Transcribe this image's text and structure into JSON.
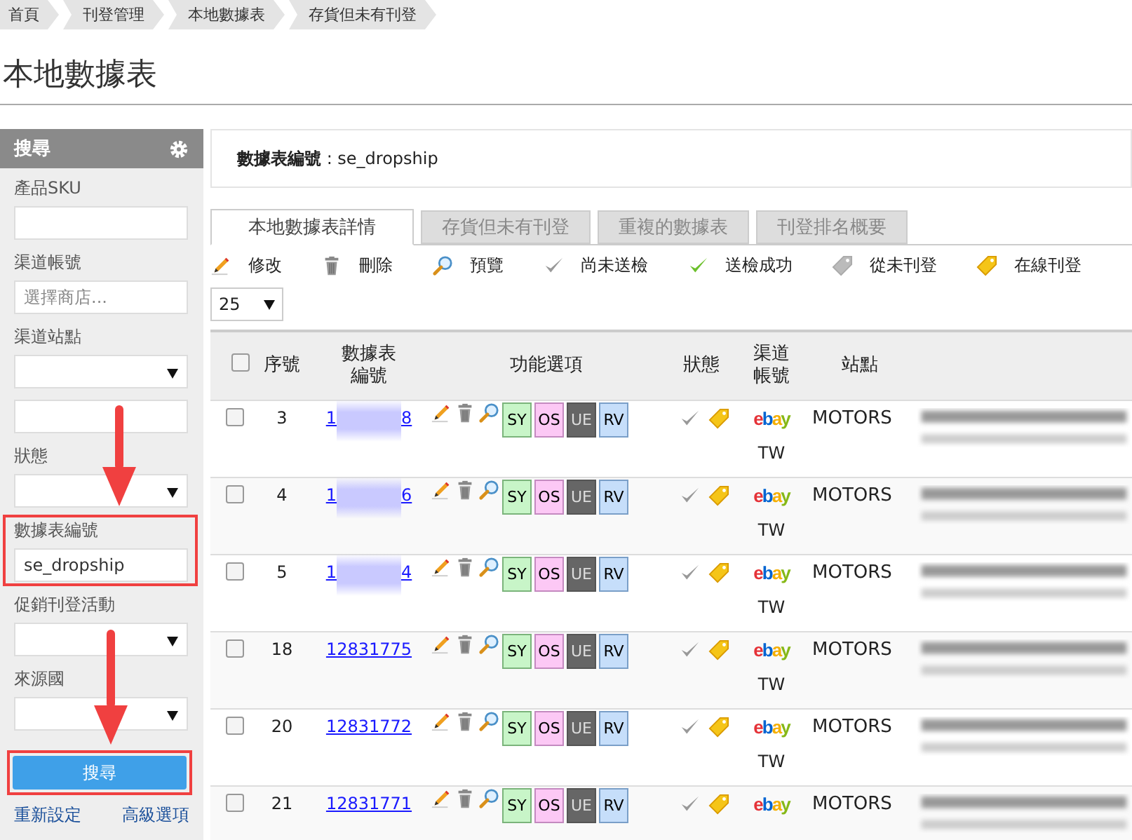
{
  "breadcrumb": [
    "首頁",
    "刊登管理",
    "本地數據表",
    "存貨但未有刊登"
  ],
  "page_title": "本地數據表",
  "sidebar": {
    "title": "搜尋",
    "fields": [
      {
        "label": "產品SKU",
        "kind": "text"
      },
      {
        "label": "渠道帳號",
        "kind": "text",
        "placeholder": "選擇商店..."
      },
      {
        "label": "渠道站點",
        "kind": "select"
      },
      {
        "kind": "text"
      },
      {
        "label": "狀態",
        "kind": "select"
      },
      {
        "label": "數據表編號",
        "kind": "text",
        "value": "se_dropship",
        "highlighted": true
      },
      {
        "label": "促銷刊登活動",
        "kind": "select"
      },
      {
        "label": "來源國",
        "kind": "select"
      }
    ],
    "search_button": {
      "label": "搜尋",
      "highlighted": true
    },
    "links": [
      "重新設定",
      "高級選項"
    ]
  },
  "filter_bar": {
    "label": "數據表編號",
    "value": ": se_dropship"
  },
  "tabs": [
    {
      "label": "本地數據表詳情",
      "selected": true
    },
    {
      "label": "存貨但未有刊登",
      "selected": false
    },
    {
      "label": "重複的數據表",
      "selected": false
    },
    {
      "label": "刊登排名概要",
      "selected": false
    }
  ],
  "legend": [
    {
      "kind": "edit",
      "label": "修改"
    },
    {
      "kind": "delete",
      "label": "刪除"
    },
    {
      "kind": "preview",
      "label": "預覽"
    },
    {
      "kind": "check-grey",
      "label": "尚未送檢"
    },
    {
      "kind": "check-green",
      "label": "送檢成功"
    },
    {
      "kind": "tag-grey",
      "label": "從未刊登"
    },
    {
      "kind": "tag-yellow",
      "label": "在線刊登"
    }
  ],
  "page_size": "25",
  "table": {
    "select_all_checked": false,
    "columns": [
      "序號",
      "數據表編號",
      "功能選項",
      "狀態",
      "渠道帳號",
      "站點"
    ],
    "rows": [
      {
        "checked": false,
        "index": "3",
        "id_start": "1",
        "id_end": "8",
        "buttons": [
          "SY",
          "OS",
          "UE",
          "RV"
        ],
        "inspected": false,
        "listed": true,
        "channel": "ebay",
        "country": "TW",
        "site": "MOTORS"
      },
      {
        "checked": false,
        "index": "4",
        "id_start": "1",
        "id_end": "6",
        "buttons": [
          "SY",
          "OS",
          "UE",
          "RV"
        ],
        "inspected": false,
        "listed": true,
        "channel": "ebay",
        "country": "TW",
        "site": "MOTORS"
      },
      {
        "checked": false,
        "index": "5",
        "id_start": "1",
        "id_end": "4",
        "buttons": [
          "SY",
          "OS",
          "UE",
          "RV"
        ],
        "inspected": false,
        "listed": true,
        "channel": "ebay",
        "country": "TW",
        "site": "MOTORS"
      },
      {
        "checked": false,
        "index": "18",
        "id": "12831775",
        "buttons": [
          "SY",
          "OS",
          "UE",
          "RV"
        ],
        "inspected": false,
        "listed": true,
        "channel": "ebay",
        "country": "TW",
        "site": "MOTORS"
      },
      {
        "checked": false,
        "index": "20",
        "id": "12831772",
        "buttons": [
          "SY",
          "OS",
          "UE",
          "RV"
        ],
        "inspected": false,
        "listed": true,
        "channel": "ebay",
        "country": "TW",
        "site": "MOTORS"
      },
      {
        "checked": false,
        "index": "21",
        "id": "12831771",
        "buttons": [
          "SY",
          "OS",
          "UE",
          "RV"
        ],
        "inspected": false,
        "listed": true,
        "channel": "ebay",
        "site": "MOTORS"
      }
    ]
  }
}
